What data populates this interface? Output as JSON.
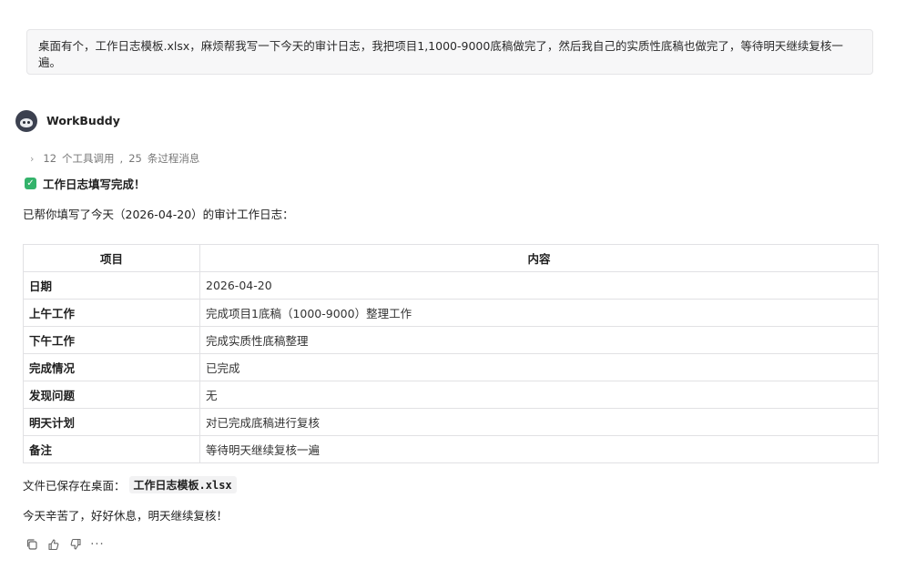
{
  "user_message": "桌面有个，工作日志模板.xlsx，麻烦帮我写一下今天的审计日志，我把项目1,1000-9000底稿做完了，然后我自己的实质性底稿也做完了，等待明天继续复核一遍。",
  "agent": {
    "name": "WorkBuddy"
  },
  "tools_summary": {
    "tool_count": "12",
    "tool_label": "个工具调用",
    "separator": ",",
    "msg_count": "25",
    "msg_label": "条过程消息"
  },
  "status": {
    "done_label": "工作日志填写完成！"
  },
  "intro_text": "已帮你填写了今天（2026-04-20）的审计工作日志：",
  "table": {
    "headers": [
      "项目",
      "内容"
    ],
    "rows": [
      [
        "日期",
        "2026-04-20"
      ],
      [
        "上午工作",
        "完成项目1底稿（1000-9000）整理工作"
      ],
      [
        "下午工作",
        "完成实质性底稿整理"
      ],
      [
        "完成情况",
        "已完成"
      ],
      [
        "发现问题",
        "无"
      ],
      [
        "明天计划",
        "对已完成底稿进行复核"
      ],
      [
        "备注",
        "等待明天继续复核一遍"
      ]
    ]
  },
  "saved": {
    "label": "文件已保存在桌面：",
    "filename": "工作日志模板.xlsx"
  },
  "closing": "今天辛苦了，好好休息，明天继续复核！",
  "actions": {
    "more": "···"
  },
  "colors": {
    "check_green": "#34b36b",
    "bubble_bg": "#f7f7f8"
  }
}
